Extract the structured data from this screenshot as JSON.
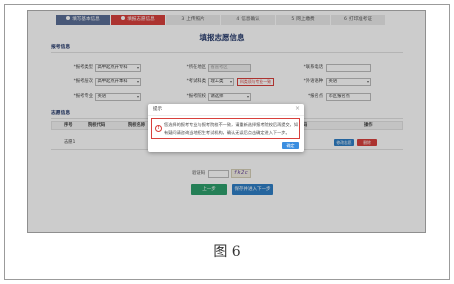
{
  "caption": "图 6",
  "colors": {
    "step_done": "#5b6f96",
    "step_active": "#d8403c",
    "primary": "#2f7fc6",
    "danger": "#d8403c",
    "success": "#2e9f6c",
    "title": "#2b3f70"
  },
  "steps": [
    {
      "label": "填写基本信息",
      "icon": "check-circle-icon"
    },
    {
      "label": "填报志愿信息",
      "icon": "check-circle-icon"
    },
    {
      "num": "3",
      "label": "上传照片"
    },
    {
      "num": "4",
      "label": "信息确认"
    },
    {
      "num": "5",
      "label": "网上缴费"
    },
    {
      "num": "6",
      "label": "打印准考证"
    }
  ],
  "page_title": "填报志愿信息",
  "sections": {
    "exam": "报考信息",
    "wishes": "志愿信息"
  },
  "form": {
    "exam_type": {
      "label": "*报考类型",
      "value": "高中起点升专科"
    },
    "region": {
      "label": "*所在地区",
      "value": "省直考区"
    },
    "phone": {
      "label": "*联系电话",
      "value": ""
    },
    "level": {
      "label": "*报考层次",
      "value": "高中起点升本科"
    },
    "subject": {
      "label": "*考试科类",
      "value": "理工类",
      "note": "科类须与专业一致"
    },
    "language": {
      "label": "*外语语种",
      "value": "英语"
    },
    "major": {
      "label": "*报考专业",
      "value": "英语"
    },
    "school": {
      "label": "*报考院校",
      "value": "请选择"
    },
    "site": {
      "label": "*报名点",
      "value": "市区报名点"
    }
  },
  "wish_table": {
    "headers": {
      "index": "序号",
      "school_code": "院校代码",
      "school_name": "院校名称",
      "major_code": "专业代码",
      "actions": "操作"
    },
    "rows": [
      {
        "index": "志愿1",
        "edit": "修改志愿",
        "delete": "删除"
      }
    ]
  },
  "captcha": {
    "label": "验证码",
    "value": "",
    "image_text": "fk2c"
  },
  "actions": {
    "prev": "上一步",
    "next": "保存并进入下一步"
  },
  "modal": {
    "title": "提示",
    "close": "×",
    "icon": "alert-icon",
    "message": "您选择的报考专业与报考院校不一致，请重新选择报考院校后再提交，如有疑问请咨询当地招生考试机构，确认无误后点击确定进入下一步。",
    "confirm": "确定"
  }
}
